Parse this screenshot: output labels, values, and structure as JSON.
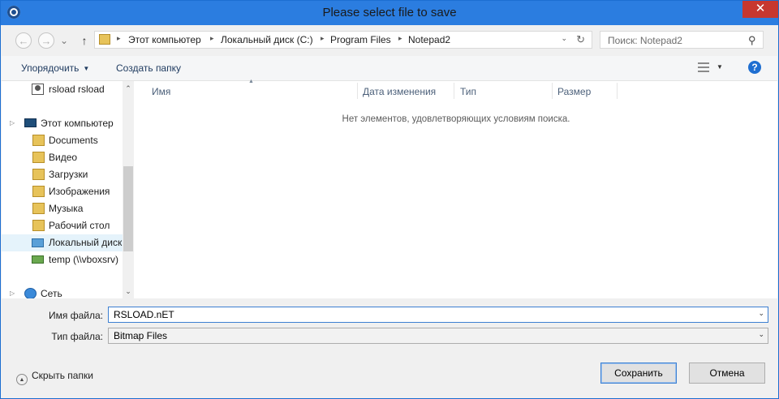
{
  "window": {
    "title": "Please select file to save",
    "close_glyph": "✕"
  },
  "nav": {
    "back_glyph": "←",
    "forward_glyph": "→",
    "recent_glyph": "⌄",
    "up_glyph": "↑",
    "breadcrumbs": [
      "Этот компьютер",
      "Локальный диск (C:)",
      "Program Files",
      "Notepad2"
    ],
    "sep_glyph": "▸",
    "dropdown_glyph": "⌄",
    "refresh_glyph": "↻",
    "search_placeholder": "Поиск: Notepad2",
    "search_glyph": "⚲"
  },
  "toolbar": {
    "organize_label": "Упорядочить",
    "organize_arrow": "▼",
    "new_folder_label": "Создать папку",
    "view_arrow": "▼",
    "help_glyph": "?"
  },
  "sidebar": {
    "items": [
      {
        "label": "rsload rsload",
        "icon": "user-icon"
      },
      {
        "label": "Этот компьютер",
        "icon": "computer-icon"
      },
      {
        "label": "Documents",
        "icon": "folder-icon"
      },
      {
        "label": "Видео",
        "icon": "folder-icon"
      },
      {
        "label": "Загрузки",
        "icon": "folder-icon"
      },
      {
        "label": "Изображения",
        "icon": "folder-icon"
      },
      {
        "label": "Музыка",
        "icon": "folder-icon"
      },
      {
        "label": "Рабочий стол",
        "icon": "folder-icon"
      },
      {
        "label": "Локальный диск",
        "icon": "drive-icon"
      },
      {
        "label": "temp (\\\\vboxsrv)",
        "icon": "network-drive-icon"
      },
      {
        "label": "Сеть",
        "icon": "network-icon"
      }
    ],
    "expand_glyph": "▷",
    "scroll_up_glyph": "⌃",
    "scroll_down_glyph": "⌄"
  },
  "filelist": {
    "columns": [
      "Имя",
      "Дата изменения",
      "Тип",
      "Размер"
    ],
    "sort_glyph": "▲",
    "empty_message": "Нет элементов, удовлетворяющих условиям поиска."
  },
  "form": {
    "filename_label": "Имя файла:",
    "filename_value": "RSLOAD.nET",
    "filetype_label": "Тип файла:",
    "filetype_value": "Bitmap Files",
    "dropdown_glyph": "⌄"
  },
  "footer": {
    "hide_folders_label": "Скрыть папки",
    "hide_glyph": "▲",
    "save_label": "Сохранить",
    "cancel_label": "Отмена"
  }
}
